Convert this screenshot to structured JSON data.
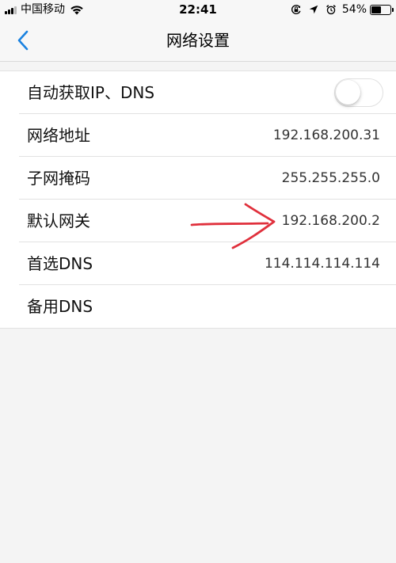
{
  "status_bar": {
    "carrier": "中国移动",
    "time": "22:41",
    "battery_percent": "54%",
    "battery_level": 0.54,
    "icons": [
      "signal-icon",
      "wifi-icon",
      "screen-lock-icon",
      "location-icon",
      "alarm-icon",
      "battery-icon"
    ]
  },
  "nav": {
    "title": "网络设置",
    "back_icon": "chevron-left-icon",
    "accent_color": "#1a82e0"
  },
  "settings": {
    "auto_ip_dns": {
      "label": "自动获取IP、DNS",
      "toggle_on": false
    },
    "ip_address": {
      "label": "网络地址",
      "value": "192.168.200.31"
    },
    "subnet_mask": {
      "label": "子网掩码",
      "value": "255.255.255.0"
    },
    "gateway": {
      "label": "默认网关",
      "value": "192.168.200.2"
    },
    "primary_dns": {
      "label": "首选DNS",
      "value": "114.114.114.114"
    },
    "secondary_dns": {
      "label": "备用DNS",
      "value": ""
    }
  },
  "annotation": {
    "type": "hand-drawn-arrow",
    "color": "#e0303c",
    "points_to": "gateway"
  }
}
